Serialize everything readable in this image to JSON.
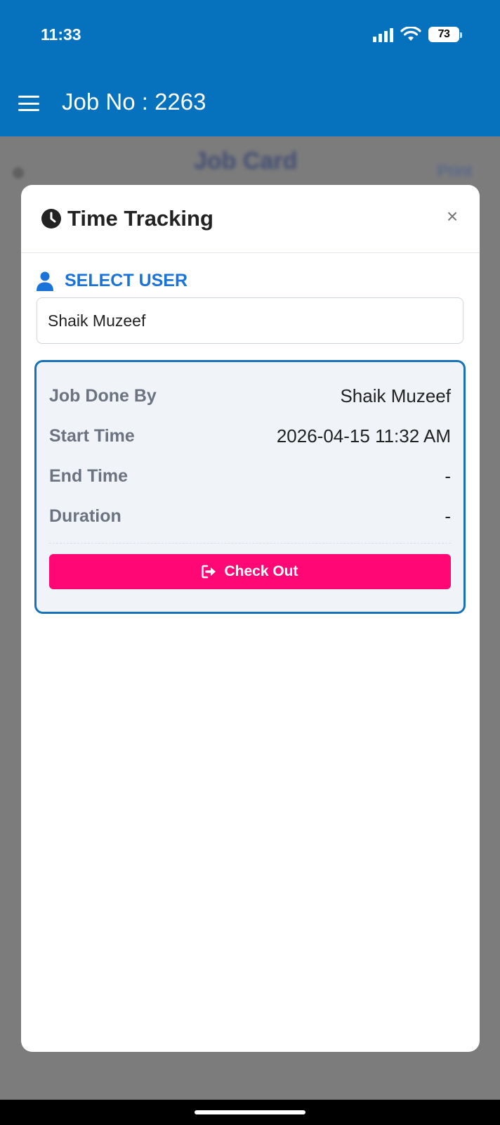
{
  "status_bar": {
    "time": "11:33",
    "battery": "73",
    "icons": [
      "signal-icon",
      "wifi-icon",
      "battery-icon"
    ]
  },
  "app_bar": {
    "title": "Job No : 2263",
    "menu_icon": "menu-icon"
  },
  "background": {
    "title": "Job Card",
    "action": "Print"
  },
  "modal": {
    "title": "Time Tracking",
    "title_icon": "clock-icon",
    "close_label": "×",
    "select_user_label": "SELECT USER",
    "selected_user": "Shaik Muzeef",
    "tracking": {
      "rows": [
        {
          "label": "Job Done By",
          "value": "Shaik Muzeef"
        },
        {
          "label": "Start Time",
          "value": "2026-04-15 11:32 AM"
        },
        {
          "label": "End Time",
          "value": "-"
        },
        {
          "label": "Duration",
          "value": "-"
        }
      ],
      "checkout_label": "Check Out",
      "checkout_icon": "logout-icon"
    }
  },
  "colors": {
    "app_bar": "#0672bd",
    "accent": "#1a73d9",
    "checkout": "#ff0774",
    "card_border": "#1772b8"
  }
}
